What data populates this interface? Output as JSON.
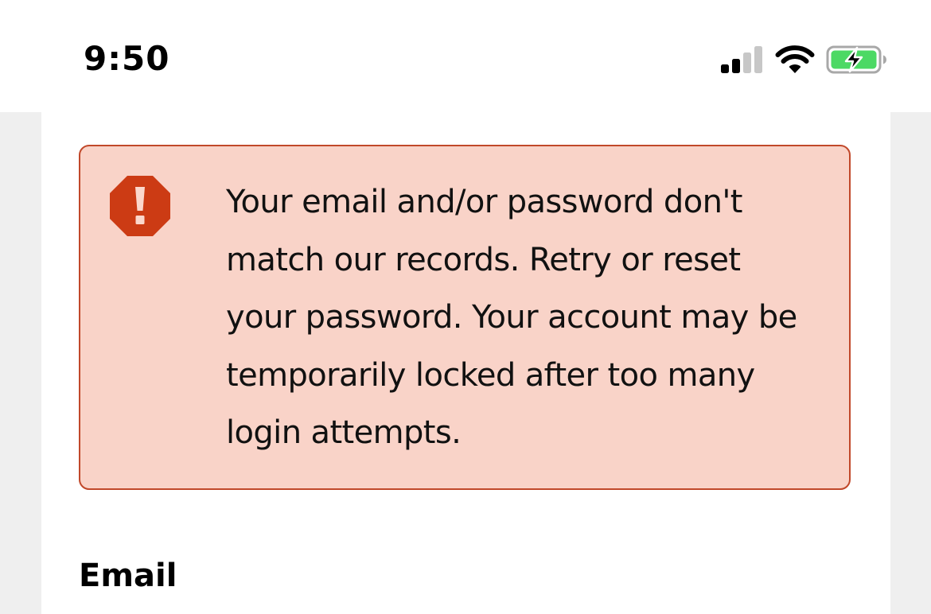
{
  "status_bar": {
    "time": "9:50",
    "icons": [
      "cellular-signal-icon",
      "wifi-icon",
      "battery-charging-icon"
    ]
  },
  "alert": {
    "icon": "error-octagon-icon",
    "message": "Your email and/or password don't match our records. Retry or reset your password. Your account may be temporarily locked after too many login attempts."
  },
  "form": {
    "email_label": "Email"
  },
  "colors": {
    "alert_background": "#f9d3c8",
    "alert_border": "#c1482a",
    "alert_icon": "#cc3b14",
    "battery_fill": "#4cd964"
  }
}
